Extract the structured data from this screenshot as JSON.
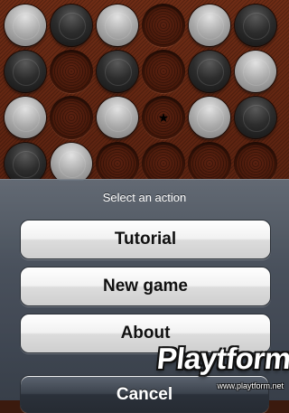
{
  "board": {
    "rows": [
      [
        "white",
        "black",
        "white",
        "empty",
        "white",
        "black"
      ],
      [
        "black",
        "empty",
        "black",
        "empty",
        "black",
        "white"
      ],
      [
        "white",
        "empty",
        "white",
        "star",
        "white",
        "black"
      ],
      [
        "black",
        "white",
        "empty",
        "empty",
        "empty",
        "empty"
      ]
    ],
    "marker_glyph": "★",
    "colors": {
      "board": "#5a2210",
      "black_piece": "#1e1e1e",
      "white_piece": "#b0b0b0"
    }
  },
  "action_sheet": {
    "title": "Select an action",
    "buttons": [
      {
        "label": "Tutorial"
      },
      {
        "label": "New game"
      },
      {
        "label": "About"
      }
    ],
    "cancel_label": "Cancel"
  },
  "watermark": {
    "brand": "Playtform",
    "url": "www.playtform.net"
  }
}
